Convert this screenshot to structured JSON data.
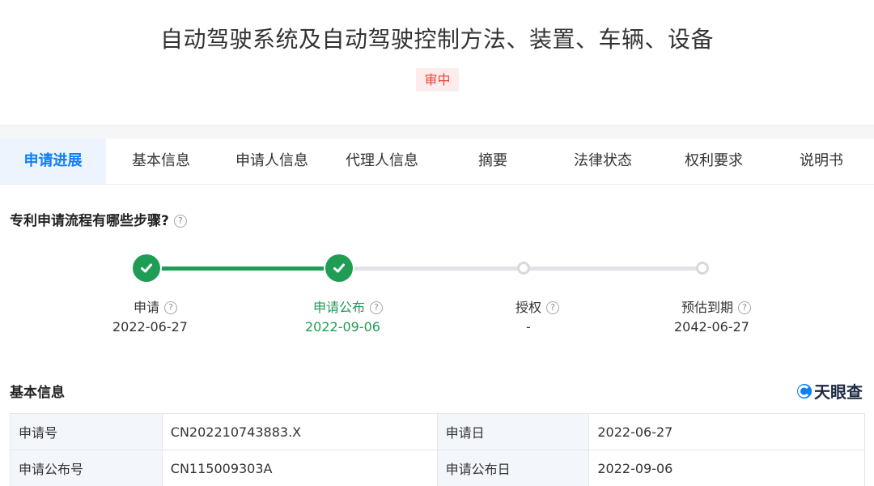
{
  "patent": {
    "title": "自动驾驶系统及自动驾驶控制方法、装置、车辆、设备",
    "status": "审中"
  },
  "tabs": [
    {
      "label": "申请进展",
      "active": true
    },
    {
      "label": "基本信息",
      "active": false
    },
    {
      "label": "申请人信息",
      "active": false
    },
    {
      "label": "代理人信息",
      "active": false
    },
    {
      "label": "摘要",
      "active": false
    },
    {
      "label": "法律状态",
      "active": false
    },
    {
      "label": "权利要求",
      "active": false
    },
    {
      "label": "说明书",
      "active": false
    }
  ],
  "process": {
    "heading": "专利申请流程有哪些步骤?",
    "help_glyph": "?",
    "steps": [
      {
        "label": "申请",
        "date": "2022-06-27",
        "state": "done"
      },
      {
        "label": "申请公布",
        "date": "2022-09-06",
        "state": "done"
      },
      {
        "label": "授权",
        "date": "-",
        "state": "pending"
      },
      {
        "label": "预估到期",
        "date": "2042-06-27",
        "state": "pending"
      }
    ]
  },
  "basic_info": {
    "heading": "基本信息",
    "logo_text": "天眼查",
    "rows": [
      {
        "k1": "申请号",
        "v1": "CN202210743883.X",
        "k2": "申请日",
        "v2": "2022-06-27"
      },
      {
        "k1": "申请公布号",
        "v1": "CN115009303A",
        "k2": "申请公布日",
        "v2": "2022-09-06"
      }
    ]
  },
  "colors": {
    "accent_blue": "#0e7ef5",
    "success_green": "#1f9d55",
    "badge_red": "#f0433a",
    "badge_bg": "#fdecec"
  }
}
